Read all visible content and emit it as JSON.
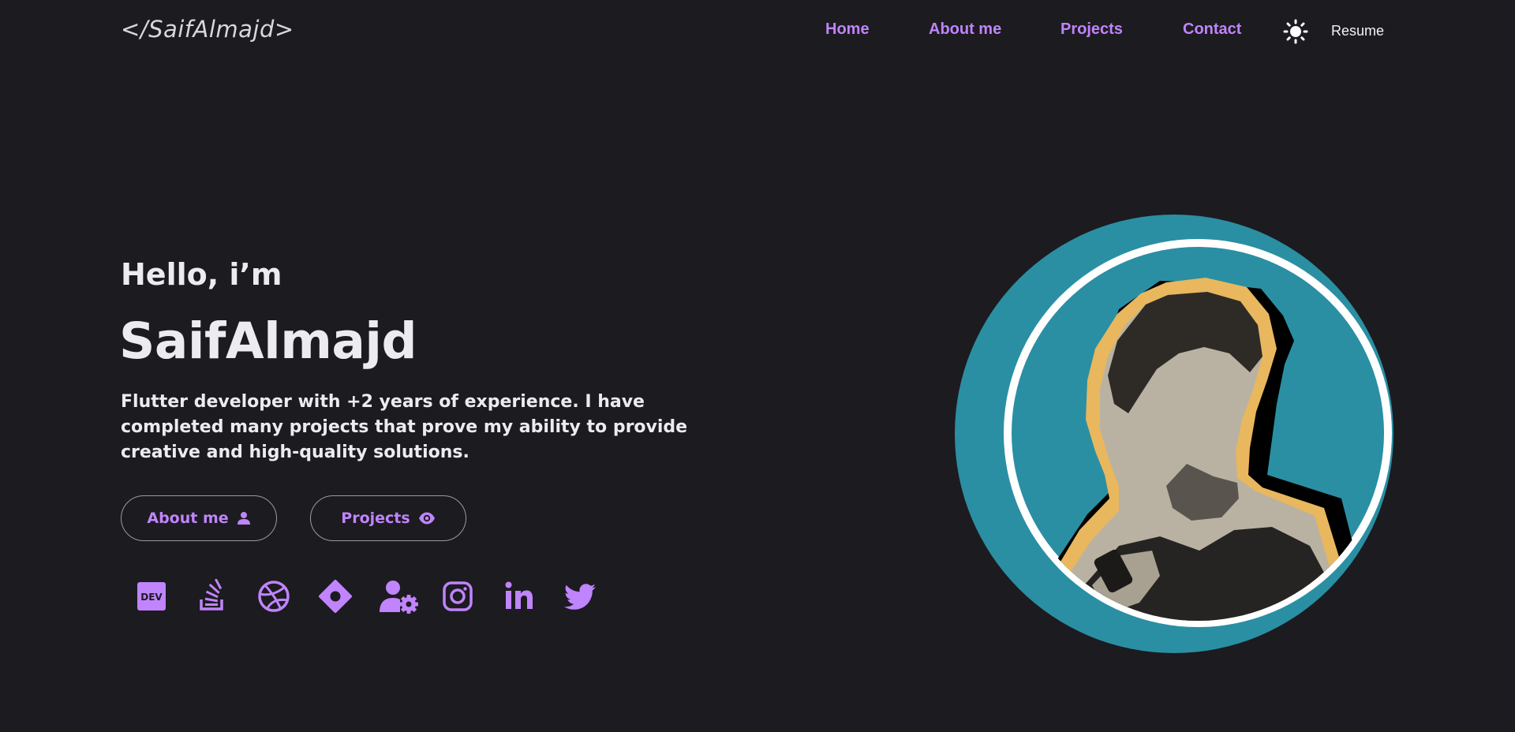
{
  "header": {
    "logo": "</SaifAlmajd>",
    "nav": [
      {
        "label": "Home"
      },
      {
        "label": "About me"
      },
      {
        "label": "Projects"
      },
      {
        "label": "Contact"
      }
    ],
    "theme_icon": "sun-icon",
    "resume_label": "Resume"
  },
  "hero": {
    "greeting": "Hello, i’m",
    "name": "SaifAlmajd",
    "bio": "Flutter developer with +2 years of experience. I have completed many projects that prove my ability to provide creative and high-quality solutions.",
    "buttons": [
      {
        "label": "About me",
        "icon": "user-icon"
      },
      {
        "label": "Projects",
        "icon": "eye-icon"
      }
    ],
    "socials": [
      {
        "name": "dev-to-icon"
      },
      {
        "name": "stackoverflow-icon"
      },
      {
        "name": "dribbble-icon"
      },
      {
        "name": "codemagic-icon"
      },
      {
        "name": "user-gear-icon"
      },
      {
        "name": "instagram-icon"
      },
      {
        "name": "linkedin-icon"
      },
      {
        "name": "twitter-icon"
      }
    ],
    "portrait": "profile-photo"
  },
  "colors": {
    "background": "#1c1b20",
    "accent": "#c084fc",
    "text": "#ececf0",
    "portrait_ring": "#2a8fa3",
    "portrait_outline": "#e8b75e"
  }
}
